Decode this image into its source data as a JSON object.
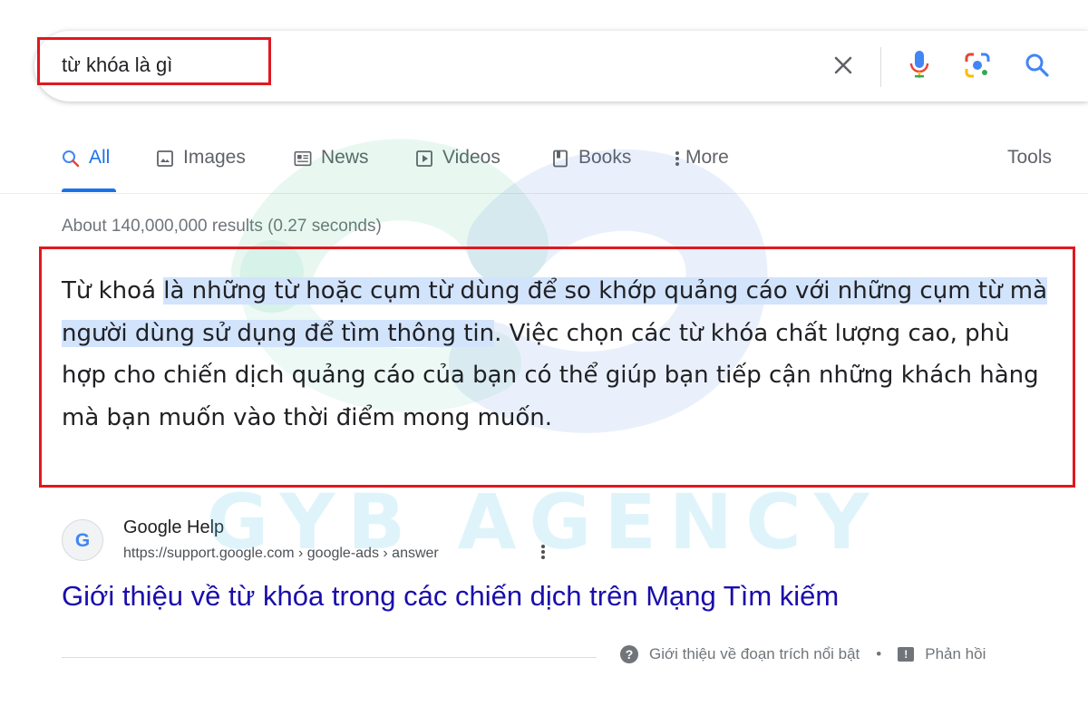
{
  "search": {
    "query": "từ khóa là gì"
  },
  "icons": {
    "clear": "close-icon",
    "voice": "microphone-icon",
    "lens": "camera-lens-icon",
    "search": "search-icon"
  },
  "tabs": [
    {
      "label": "All",
      "icon": "search-icon",
      "active": true
    },
    {
      "label": "Images",
      "icon": "image-icon"
    },
    {
      "label": "News",
      "icon": "newspaper-icon"
    },
    {
      "label": "Videos",
      "icon": "play-icon"
    },
    {
      "label": "Books",
      "icon": "book-icon"
    },
    {
      "label": "More",
      "icon": "kebab-icon"
    }
  ],
  "tools_label": "Tools",
  "result_stats": "About 140,000,000 results (0.27 seconds)",
  "snippet": {
    "pre": "Từ khoá ",
    "highlight": "là những từ hoặc cụm từ dùng để so khớp quảng cáo với những cụm từ mà người dùng sử dụng để tìm thông tin",
    "post": ". Việc chọn các từ khóa chất lượng cao, phù hợp cho chiến dịch quảng cáo của bạn có thể giúp bạn tiếp cận những khách hàng mà bạn muốn vào thời điểm mong muốn."
  },
  "result": {
    "site_name": "Google Help",
    "url": "https://support.google.com › google-ads › answer",
    "title": "Giới thiệu về từ khóa trong các chiến dịch trên Mạng Tìm kiếm",
    "favicon_letter": "G"
  },
  "footer": {
    "about_label": "Giới thiệu về đoạn trích nổi bật",
    "separator": "•",
    "feedback_label": "Phản hồi"
  },
  "watermark": {
    "text": "GYB AGENCY"
  },
  "colors": {
    "accent": "#1a73e8",
    "link": "#1a0dab",
    "highlight": "#d2e3fc",
    "annotation_box": "#e0181f"
  }
}
